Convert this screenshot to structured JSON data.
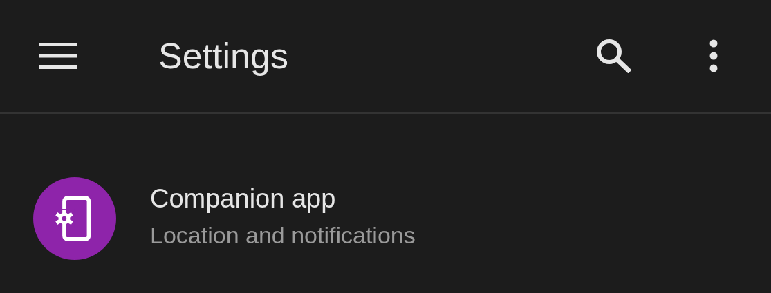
{
  "toolbar": {
    "title": "Settings"
  },
  "items": [
    {
      "title": "Companion app",
      "subtitle": "Location and notifications",
      "color": "#8e24aa"
    }
  ]
}
